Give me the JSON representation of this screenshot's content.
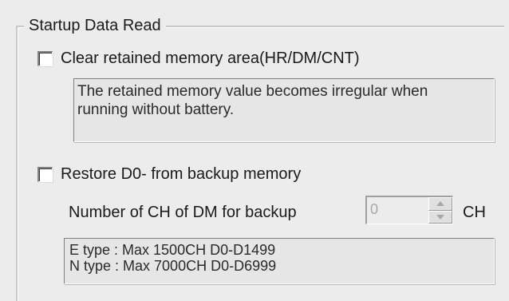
{
  "group": {
    "title": "Startup Data Read"
  },
  "clear_retained": {
    "label": "Clear retained memory area(HR/DM/CNT)",
    "checked": false,
    "info_lines": [
      "The retained memory value becomes irregular when",
      "running without battery."
    ]
  },
  "restore": {
    "label": "Restore D0- from backup memory",
    "checked": false,
    "dm_label": "Number of CH of DM for backup",
    "dm_value": "0",
    "dm_unit": "CH",
    "type_lines": [
      "E type : Max 1500CH   D0-D1499",
      "N type : Max 7000CH   D0-D6999"
    ]
  },
  "icons": {
    "spin_up": "triangle-up-icon",
    "spin_down": "triangle-down-icon"
  }
}
